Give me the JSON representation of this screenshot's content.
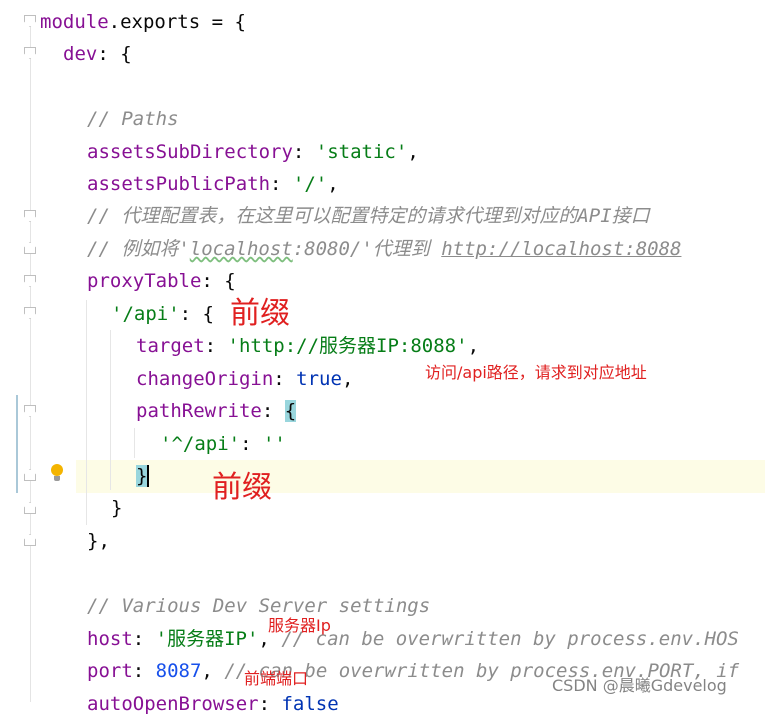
{
  "editor": {
    "lines": {
      "l1": {
        "a": "module",
        "b": ".exports = {"
      },
      "l2": {
        "a": "dev",
        "b": ": {"
      },
      "l4": {
        "a": "// Paths"
      },
      "l5": {
        "a": "assetsSubDirectory",
        "b": ": ",
        "c": "'static'",
        "d": ","
      },
      "l6": {
        "a": "assetsPublicPath",
        "b": ": ",
        "c": "'/'",
        "d": ","
      },
      "l7": {
        "a": "// 代理配置表，在这里可以配置特定的请求代理到对应的API接口"
      },
      "l8": {
        "a": "// 例如将'",
        "b": "localhost",
        "c": ":8080/'代理到 ",
        "d": "http://localhost:8088"
      },
      "l9": {
        "a": "proxyTable",
        "b": ": {"
      },
      "l10": {
        "a": "'/api'",
        "b": ": {"
      },
      "l11": {
        "a": "target",
        "b": ": ",
        "c": "'http://服务器IP:8088'",
        "d": ","
      },
      "l12": {
        "a": "changeOrigin",
        "b": ": ",
        "c": "true",
        "d": ","
      },
      "l13": {
        "a": "pathRewrite",
        "b": ": ",
        "c": "{"
      },
      "l14": {
        "a": "'^/api'",
        "b": ": ",
        "c": "''"
      },
      "l15": {
        "a": "}"
      },
      "l16": {
        "a": "}"
      },
      "l17": {
        "a": "},"
      },
      "l19": {
        "a": "// Various Dev Server settings"
      },
      "l20": {
        "a": "host",
        "b": ": ",
        "c": "'服务器IP'",
        "d": ", ",
        "e": "// can be overwritten by process.env.HOS"
      },
      "l21": {
        "a": "port",
        "b": ": ",
        "c": "8087",
        "d": ", ",
        "e": "// can be overwritten by process.env.PORT, if"
      },
      "l22": {
        "a": "autoOpenBrowser",
        "b": ": ",
        "c": "false"
      }
    }
  },
  "annotations": {
    "prefix_1": "前缀",
    "api_path_note": "访问/api路径，请求到对应地址",
    "prefix_2": "前缀",
    "server_ip_note": "服务器Ip",
    "frontend_port_note": "前端端口"
  },
  "watermark": "CSDN @晨曦Gdevelog",
  "colors": {
    "annotation": "#e02020",
    "string": "#067d17",
    "keyword": "#871094",
    "number": "#1750eb",
    "comment": "#8c8c8c"
  }
}
